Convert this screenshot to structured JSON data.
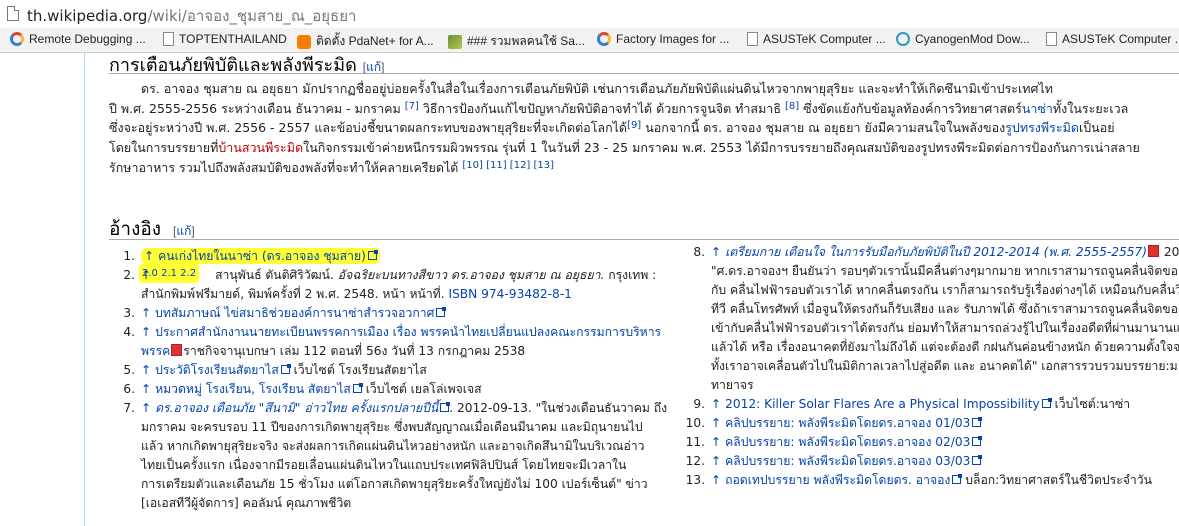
{
  "browser": {
    "url_host": "th.wikipedia.org",
    "url_path": "/wiki/อาจอง_ชุมสาย_ณ_อยุธยา",
    "bookmarks": [
      {
        "label": "Remote Debugging ...",
        "icon": "chrome-icon"
      },
      {
        "label": "TOPTENTHAILAND",
        "icon": "page-icon"
      },
      {
        "label": "ติดตั้ง PdaNet+ for A...",
        "icon": "blogger-icon"
      },
      {
        "label": "### รวมพลคนใช้ Sa...",
        "icon": "puzzle-icon"
      },
      {
        "label": "Factory Images for ...",
        "icon": "chrome-icon"
      },
      {
        "label": "ASUSTeK Computer ...",
        "icon": "page-icon"
      },
      {
        "label": "CyanogenMod Dow...",
        "icon": "cyanogen-icon"
      },
      {
        "label": "ASUSTeK Computer ...",
        "icon": "page-icon"
      }
    ]
  },
  "article": {
    "section_heading": "การเตือนภัยพิบัติและพลังพีระมิด",
    "edit_label": "แก้",
    "paragraph": {
      "l1": "ดร. อาจอง ชุมสาย ณ อยุธยา มักปรากฏชื่ออยู่บ่อยครั้งในสื่อในเรื่องการเตือนภัยพิบัติ เช่นการเตือนภัยภัยพิบัติแผ่นดินไหวจากพายุสุริยะ และจะทำให้เกิดซึนามิเข้าประเทศไท",
      "l2a": "ปี พ.ศ. 2555-2556 ระหว่างเดือน ธันวาคม - มกราคม",
      "l2s1": "[7]",
      "l2b": " วิธีการป้องกันแก้ไขปัญหาภัยพิบัติอาจทำได้ ด้วยการจูนจิต ทำสมาธิ",
      "l2s2": "[8]",
      "l2c": " ซึ่งขัดแย้งกับข้อมูลท้องค์การวิทยาศาสตร์",
      "l2link": "นาซ่า",
      "l2d": "ทั้งในระยะเวล",
      "l3a": "ซึ่งจะอยู่ระหว่างปี พ.ศ. 2556 - 2557 และข้อบ่งชี้ขนาดผลกระทบของพายุสุริยะที่จะเกิดต่อโลกได้",
      "l3s": "[9]",
      "l3b": " นอกจากนี้ ดร. อาจอง ชุมสาย ณ อยุธยา ยังมีความสนใจในพลังของ",
      "l3link": "รูปทรงพีระมิด",
      "l3c": "เป็นอย่",
      "l4a": "โดยในการบรรยายที่",
      "l4red": "บ้านสวนพีระมิด",
      "l4b": "ในกิจกรรมเข้าค่ายหนีกรรมผิวพรรณ รุ่นที่ 1 ในวันที่ 23 - 25 มกราคม พ.ศ. 2553 ได้มีการบรรยายถึงคุณสมบัติของรูปทรงพีระมิดต่อการป้องกันการเน่าสลาย",
      "l5a": "รักษาอาหาร รวมไปถึงพลังสมบัติของพลังที่จะทำให้คลายเครียดได้",
      "l5s": "[10] [11] [12] [13]"
    },
    "ref_heading": "อ้างอิง",
    "refs_left": {
      "r1_num": "1.",
      "r1_link": "↑ คนเก่งไทยในนาซ่า (ดร.อาจอง ชุมสาย)",
      "r1_sub": "2.0 2.1 2.2",
      "r2_num": "2.",
      "r2_a": "↑ ",
      "r2_b": "สานุพันธ์ ตันติศิริวัฒน์. ",
      "r2_ital": "อัจฉริยะบนทางสีขาว ดร.อาจอง ชุมสาย ณ อยุธยา.",
      "r2_c": " กรุงเทพ :",
      "r2_l2a": "สำนักพิมพ์ฟรีมายด์, พิมพ์ครั้งที่ 2 พ.ศ. 2548. หน้า หน้าที่. ",
      "r2_l2link": "ISBN 974-93482-8-1",
      "r3_num": "3.",
      "r3_link": "↑ บทสัมภาษณ์ ไข่สมาธิช่วยองค์การนาซ่าสำรวจอวกาศ",
      "r4_num": "4.",
      "r4_link": "↑ ประกาศสำนักงานนายทะเบียนพรรคการเมือง เรื่อง พรรคนำไทยเปลี่ยนแปลงคณะกรรมการบริหาร",
      "r4_l2link": "พรรค",
      "r4_l2b": "ราชกิจจานุเบกษา เล่ม 112 ตอนที่ 56ง วันที่ 13 กรกฎาคม 2538",
      "r5_num": "5.",
      "r5_link": "↑ ประวัติโรงเรียนสัตยาไส",
      "r5_b": " เว็บไซต์ โรงเรียนสัตยาไส",
      "r6_num": "6.",
      "r6_link": "↑ หมวดหมู่ โรงเรียน, โรงเรียน สัตยาไส",
      "r6_b": " เว็บไซต์ เยลโล่เพจเจส",
      "r7_num": "7.",
      "r7_link": "↑ ดร.อาจอง เตือนภัย \"สึนามิ\" อ่าวไทย ครั้งแรกปลายปีนี้",
      "r7_b": ". 2012-09-13. \"ในช่วงเดือนธันวาคม ถึง",
      "r7_l2": "มกราคม จะครบรอบ 11 ปีของการเกิดพายุสุริยะ ซึ่งพบสัญญาณเมื่อเดือนมีนาคม และมิถุนายนไป",
      "r7_l3": "แล้ว หากเกิดพายุสุริยะจริง จะส่งผลการเกิดแผ่นดินไหวอย่างหนัก และอาจเกิดสึนามิในบริเวณอ่าว",
      "r7_l4": "ไทยเป็นครั้งแรก เนื่องจากมีรอยเลื่อนแผ่นดินไหวในแถบประเทศฟิลิปปินส์ โดยไทยจะมีเวลาใน",
      "r7_l5": "การเตรียมตัวและเดือนภัย 15 ชั่วโมง แต่โอกาสเกิดพายุสุริยะครั้งใหญ่ยังไม่ 100 เปอร์เซ็นต์\" ข่าว",
      "r7_l6": "[เอเอสทีวีผู้จัดการ] คอลัมน์ คุณภาพชีวิต"
    },
    "refs_right": {
      "r8_num": "8.",
      "r8_link": "↑ เตรียมกาย เตือนใจ ในการรับมือกับภัยพิบัติในปี 2012-2014 (พ.ศ. 2555-2557)",
      "r8_b": " 201",
      "r8_l2": "\"ศ.ดร.อาจองฯ ยืนยันว่า รอบๆตัวเรานั้นมีคลื่นต่างๆมากมาย หากเราสามารถจูนคลื่นจิตของเร",
      "r8_l3": "กับ คลื่นไฟฟ้ารอบตัวเราได้ หากคลื่นตรงกัน เราก็สามารถรับรู้เรื่องต่างๆได้ เหมือนกับคลื่นวิ",
      "r8_l4": "ทีวี คลื่นโทรศัพท์ เมื่อจูนให้ตรงกันก็รับเสียง และ รับภาพได้ ซึ่งถ้าเราสามารถจูนคลื่นจิตของ",
      "r8_l5": "เข้ากับคลื่นไฟฟ้ารอบตัวเราได้ตรงกัน ย่อมทำให้สามารถล่วงรู้ไปในเรื่องอดีตที่ผ่านมานานแล",
      "r8_l6": "แล้วได้ หรือ เรื่องอนาคตที่ยังมาไม่ถึงได้ แต่จะต้องดี กฝนกันค่อนข้างหนัก ด้วยความตั้งใจจ",
      "r8_l7": "ทั้งเราอาจเคลื่อนตัวไปในมิติกาลเวลาไปสู่อดีต และ อนาคตได้\" เอกสารรวบรวมบรรยาย:ม",
      "r8_l8": "ทายาจร",
      "r9_num": "9.",
      "r9_link": "↑ 2012: Killer Solar Flares Are a Physical Impossibility",
      "r9_b": " เว็บไซต์:นาซ่า",
      "r10_num": "10.",
      "r10_link": "↑ คลิปบรรยาย: พลังพีระมิดโดยดร.อาจอง 01/03",
      "r11_num": "11.",
      "r11_link": "↑ คลิปบรรยาย: พลังพีระมิดโดยดร.อาจอง 02/03",
      "r12_num": "12.",
      "r12_link": "↑ คลิปบรรยาย: พลังพีระมิดโดยดร.อาจอง 03/03",
      "r13_num": "13.",
      "r13_link": "↑ ถอดเทปบรรยาย พลังพีระมิดโดยดร. อาจอง",
      "r13_b": " บล็อก:วิทยาศาสตร์ในชีวิตประจำวัน"
    }
  }
}
